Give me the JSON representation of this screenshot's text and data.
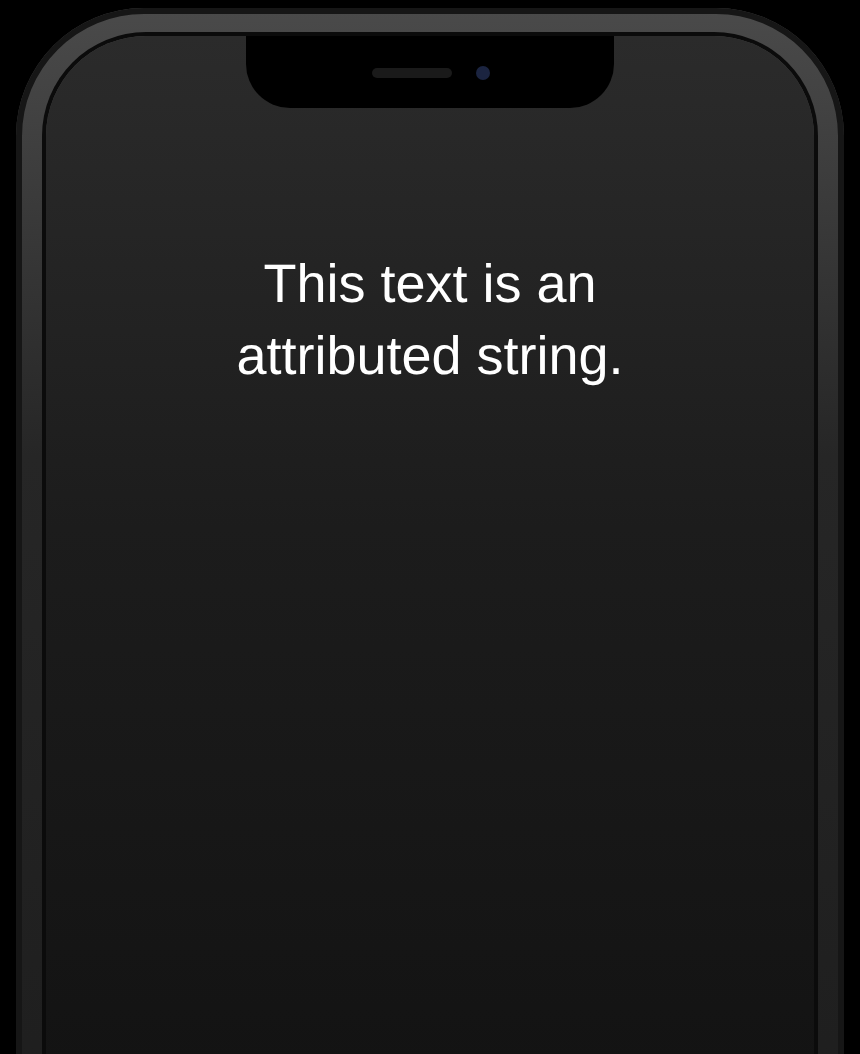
{
  "screen": {
    "text": "This text is an attributed string."
  }
}
